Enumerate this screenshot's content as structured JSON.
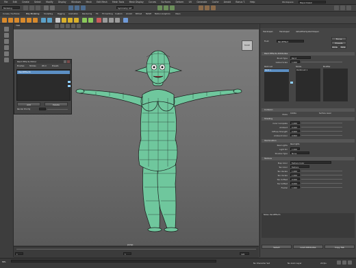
{
  "menubar": {
    "items": [
      "File",
      "Edit",
      "Create",
      "Select",
      "Modify",
      "Display",
      "Windows",
      "Mesh",
      "Edit Mesh",
      "Mesh Tools",
      "Mesh Display",
      "Curves",
      "Surfaces",
      "Deform",
      "UV",
      "Generate",
      "Cache",
      "Arnold",
      "Bonus T.",
      "Help"
    ],
    "workspace_label": "Workspace:",
    "workspace_value": "Maya Classic"
  },
  "statusline": {
    "mode": "Modeling",
    "symmetry": "Symmetry: Off"
  },
  "shelf_tabs": [
    "Curves / Surfaces",
    "Poly Modeling",
    "Sculpting",
    "Rigging",
    "Animation",
    "Rendering",
    "FX",
    "FX Caching",
    "Custom",
    "Arnold",
    "Bifrost",
    "MASH",
    "Motion Graphics",
    "XGen"
  ],
  "viewport": {
    "camera_label": "persp",
    "view_cube": "FRONT"
  },
  "timeline": {
    "start": "1",
    "end": "120",
    "current": "1"
  },
  "cmdline": {
    "lang": "MEL",
    "char_set": "No Character Set",
    "anim_layer": "No Anim Layer",
    "fps": "24 fps"
  },
  "dialog": {
    "title": "Paint Effects Editor",
    "tabs": [
      "Brushes",
      "Strokes",
      "Wind",
      "Presets"
    ],
    "selected_item": "PaintEffect1",
    "buttons": [
      "Add",
      "Delete"
    ],
    "footer_label": "Render Priority"
  },
  "attr_editor": {
    "node_tabs": [
      "Hairshape1",
      "Hairshape2",
      "defaultHairSystemShape1"
    ],
    "type_label": "Fluid:",
    "type_value": "PaintEffect",
    "focus_btn": "Focus",
    "presets_btn": "Presets",
    "show_btn": "Show",
    "hide_btn": "Hide",
    "section1": "Paint Effects Attributes",
    "section1_rows": [
      {
        "label": "Brush Type",
        "value": "Paint"
      },
      {
        "label": "Global Scale",
        "value": "1.000"
      }
    ],
    "lists": {
      "list1_title": "Paint List",
      "list1_item": "Paint 1",
      "list2_title": "Stroke",
      "list2_item": "Paintbrush 1",
      "list3_title": "Modifier"
    },
    "section2": "Collision",
    "section2_rows": [
      {
        "label": "Mode",
        "value": "Collide",
        "extra": "Surface Level"
      }
    ],
    "section3": "Shading",
    "section3_rows": [
      {
        "label": "Color Complete",
        "value": "1.000"
      },
      {
        "label": "Ambient",
        "value": "0.000"
      },
      {
        "label": "Diffuse Strength",
        "value": "0.600"
      },
      {
        "label": "Ambient Color",
        "value": "0.800"
      }
    ],
    "section4": "Illumination",
    "section4_rows": [
      {
        "label": "Real Lights",
        "value": "Real lights"
      },
      {
        "label": "Light Dir",
        "value": "1.000"
      },
      {
        "label": "Shadow Type",
        "value": "None"
      }
    ],
    "section5": "Texture",
    "section5_rows": [
      {
        "label": "Map Color",
        "value": "Texture Color"
      },
      {
        "label": "Tex Color",
        "value": "Texture"
      },
      {
        "label": "Tex Uscale",
        "value": "1.000"
      },
      {
        "label": "Tex Vscale",
        "value": "1.000"
      },
      {
        "label": "Tex Uoffset",
        "value": "0.000"
      },
      {
        "label": "Tex Voffset",
        "value": "0.000"
      },
      {
        "label": "Fractal",
        "value": "1.000"
      }
    ],
    "notes_label": "Notes: PaintEffect1",
    "bottom_buttons": [
      "Select",
      "Load Attributes",
      "Copy Tab"
    ]
  },
  "colors": {
    "accent": "#5c8fc4",
    "mesh": "#67c29a",
    "wire": "#1a1a1a"
  }
}
